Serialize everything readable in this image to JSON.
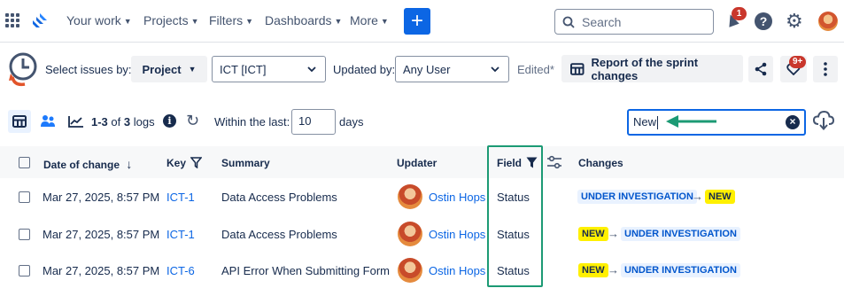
{
  "topnav": {
    "items": [
      {
        "label": "Your work"
      },
      {
        "label": "Projects"
      },
      {
        "label": "Filters"
      },
      {
        "label": "Dashboards"
      },
      {
        "label": "More"
      }
    ],
    "create_label": "+",
    "search_placeholder": "Search",
    "notifications_count": "1",
    "help_label": "?"
  },
  "header": {
    "select_issues_label": "Select issues by:",
    "project_button": "Project",
    "project_value": "ICT [ICT]",
    "updated_by_label": "Updated by:",
    "updated_by_value": "Any User",
    "edited_label": "Edited*",
    "report_button": "Report of the sprint changes",
    "more_badge": "9+"
  },
  "toolbar": {
    "logs_range": "1-3",
    "logs_of": "of",
    "logs_total": "3",
    "logs_suffix": "logs",
    "info_label": "i",
    "within_label": "Within the last:",
    "days_value": "10",
    "days_label": "days",
    "filter_value": "New"
  },
  "table": {
    "columns": {
      "date": "Date of change",
      "key": "Key",
      "summary": "Summary",
      "updater": "Updater",
      "field": "Field",
      "changes": "Changes"
    },
    "rows": [
      {
        "date": "Mar 27, 2025, 8:57 PM",
        "key": "ICT-1",
        "summary": "Data Access Problems",
        "updater": "Ostin Hops",
        "field": "Status",
        "from": "UNDER INVESTIGATION",
        "to": "NEW"
      },
      {
        "date": "Mar 27, 2025, 8:57 PM",
        "key": "ICT-1",
        "summary": "Data Access Problems",
        "updater": "Ostin Hops",
        "field": "Status",
        "from": "NEW",
        "to": "UNDER INVESTIGATION"
      },
      {
        "date": "Mar 27, 2025, 8:57 PM",
        "key": "ICT-6",
        "summary": "API Error When Submitting Form",
        "updater": "Ostin Hops",
        "field": "Status",
        "from": "NEW",
        "to": "UNDER INVESTIGATION"
      }
    ]
  },
  "colors": {
    "accent": "#0c66e4",
    "highlight_box": "#1c9a74",
    "new_lozenge": "#fff000",
    "badge_red": "#c9372c"
  }
}
